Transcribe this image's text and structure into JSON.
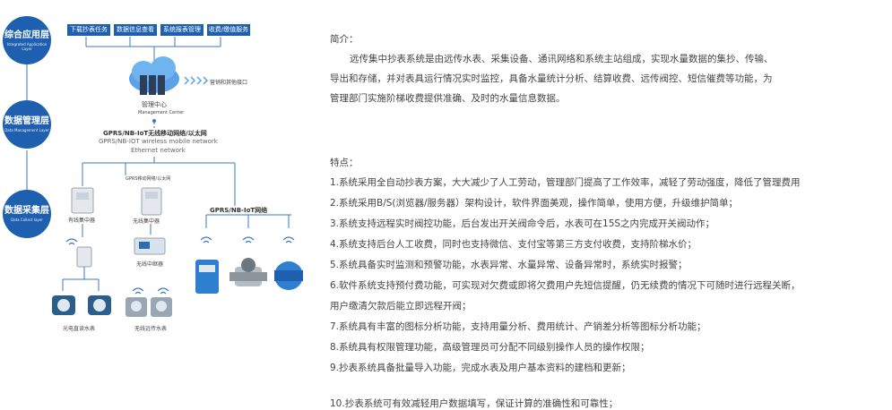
{
  "diagram": {
    "layers": [
      {
        "cn": "综合应用层",
        "en": "Integrated Application Layer"
      },
      {
        "cn": "数据管理层",
        "en": "Data Management Layer"
      },
      {
        "cn": "数据采集层",
        "en": "Data Collect layer"
      }
    ],
    "services": [
      "下载抄表任务",
      "数据信息查看",
      "系统报表管理",
      "收费/缴值服务"
    ],
    "cloud_label": "营销和其他接口",
    "center_cn": "管理中心",
    "center_en": "Management Center",
    "network_cn": "GPRS/NB-IoT无线移动网络/以太网",
    "network_en": "GPRS/NB-IOT wireless mobile network",
    "network_en2": "Ethernet network",
    "gprs_small": "GPRS移动网络/以太网",
    "wired_concentrator": "有线集中器",
    "wireless_concentrator": "无线集中器",
    "wireless_repeater": "无线中继器",
    "gprs_nb_label": "GPRS/NB-IoT网络",
    "wired_meter_label": "光电直读水表",
    "wireless_meter_label": "无线远传水表"
  },
  "intro": {
    "heading": "简介：",
    "lines": [
      "远传集中抄表系统是由远传水表、采集设备、通讯网络和系统主站组成，实现水量数据的集抄、传输、",
      "导出和存储，并对表具运行情况实时监控，具备水量统计分析、结算收费、远传阀控、短信催费等功能，为",
      "管理部门实施阶梯收费提供准确、及时的水量信息数据。"
    ]
  },
  "features": {
    "heading": "特点：",
    "lines": [
      "1.系统采用全自动抄表方案，大大减少了人工劳动，管理部门提高了工作效率，减轻了劳动强度，降低了管理费用",
      "2.系统采用B/S(浏览器/服务器）架构设计，软件界面美观，操作简单，使用方便，升级维护简单；",
      "3.系统支持远程实时阀控功能，后台发出开关阀命令后，水表可在15S之内完成开关阀动作；",
      "4.系统支持后台人工收费，同时也支持微信、支付宝等第三方支付收费，支持阶梯水价；",
      "5.系统具备实时监测和预警功能，水表异常、水量异常、设备异常时，系统实时报警；",
      "6.软件系统支持预付费功能，可实现对欠费或即将欠费用户先短信提醒，仍无续费的情况下可随时进行远程关断，",
      "用户缴清欠款后能立即远程开阀；",
      "7.系统具有丰富的图标分析功能，支持用量分析、费用统计、产销差分析等图标分析功能；",
      "8.系统具有权限管理功能，高级管理员可分配不同级别操作人员的操作权限；",
      "9.抄表系统具备批量导入功能，完成水表及用户基本资料的建档和更新；",
      "10.抄表系统可有效减轻用户数据填写，保证计算的准确性和可靠性；"
    ]
  }
}
